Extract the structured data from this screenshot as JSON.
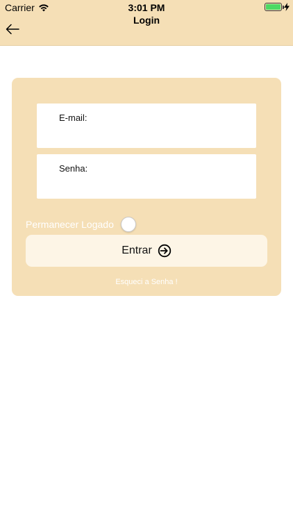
{
  "status_bar": {
    "carrier": "Carrier",
    "time": "3:01 PM",
    "wifi_icon": "wifi-icon",
    "battery_icon": "battery-icon",
    "charging_icon": "bolt-icon",
    "battery_color": "#4cd964"
  },
  "nav": {
    "title": "Login",
    "back_icon": "arrow-left-icon"
  },
  "form": {
    "email_label": "E-mail:",
    "email_value": "",
    "senha_label": "Senha:",
    "senha_value": "",
    "remember_label": "Permanecer Logado",
    "remember_checked": false,
    "enter_label": "Entrar",
    "enter_icon": "sign-in-icon",
    "forgot_label": "Esqueci a Senha !"
  },
  "colors": {
    "accent": "#f5dfb6",
    "button_bg": "#fdf5e6",
    "background": "#ffffff"
  }
}
